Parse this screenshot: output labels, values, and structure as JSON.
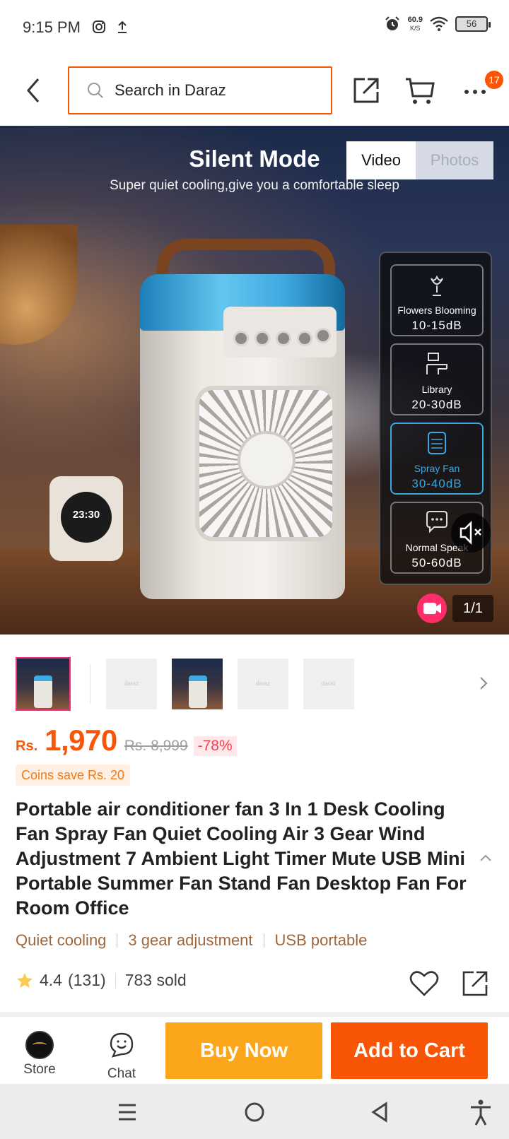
{
  "status_bar": {
    "time": "9:15 PM",
    "left_icons": [
      "instagram-icon",
      "upload-icon"
    ],
    "net_speed_value": "60.9",
    "net_speed_unit": "K/S",
    "battery": "56"
  },
  "header": {
    "search_placeholder": "Search in Daraz",
    "cart_badge": "17",
    "accent": "#f85606"
  },
  "hero": {
    "title": "Silent Mode",
    "subtitle": "Super quiet cooling,give you a comfortable sleep",
    "media_tabs": [
      "Video",
      "Photos"
    ],
    "active_tab": "Video",
    "clock_text": "23:30",
    "modes": [
      {
        "name": "Flowers Blooming",
        "db": "10-15dB",
        "icon": "flower-icon"
      },
      {
        "name": "Library",
        "db": "20-30dB",
        "icon": "library-icon"
      },
      {
        "name": "Spray Fan",
        "db": "30-40dB",
        "icon": "spray-fan-icon"
      },
      {
        "name": "Normal Speak",
        "db": "50-60dB",
        "icon": "chat-bubble-icon"
      }
    ],
    "image_counter": "1/1"
  },
  "thumbnails": [
    {
      "kind": "image",
      "selected": true
    },
    {
      "kind": "placeholder",
      "label": "daraz"
    },
    {
      "kind": "image",
      "selected": false
    },
    {
      "kind": "placeholder",
      "label": "daraz"
    },
    {
      "kind": "placeholder",
      "label": "daraz"
    }
  ],
  "price": {
    "currency": "Rs.",
    "current": "1,970",
    "original": "Rs. 8,999",
    "discount": "-78%",
    "coins_note": "Coins save Rs. 20"
  },
  "product": {
    "title": "Portable air conditioner fan 3 In 1 Desk Cooling Fan Spray Fan Quiet Cooling Air 3 Gear Wind Adjustment 7 Ambient Light Timer Mute USB Mini Portable Summer Fan Stand Fan Desktop Fan For Room Office",
    "tags": [
      "Quiet cooling",
      "3 gear adjustment",
      "USB portable"
    ],
    "rating": "4.4",
    "review_count": "(131)",
    "sold": "783 sold"
  },
  "action_bar": {
    "store_label": "Store",
    "chat_label": "Chat",
    "buy_now": "Buy Now",
    "add_to_cart": "Add to Cart",
    "buy_color": "#fca61c",
    "cart_color": "#f85606"
  }
}
